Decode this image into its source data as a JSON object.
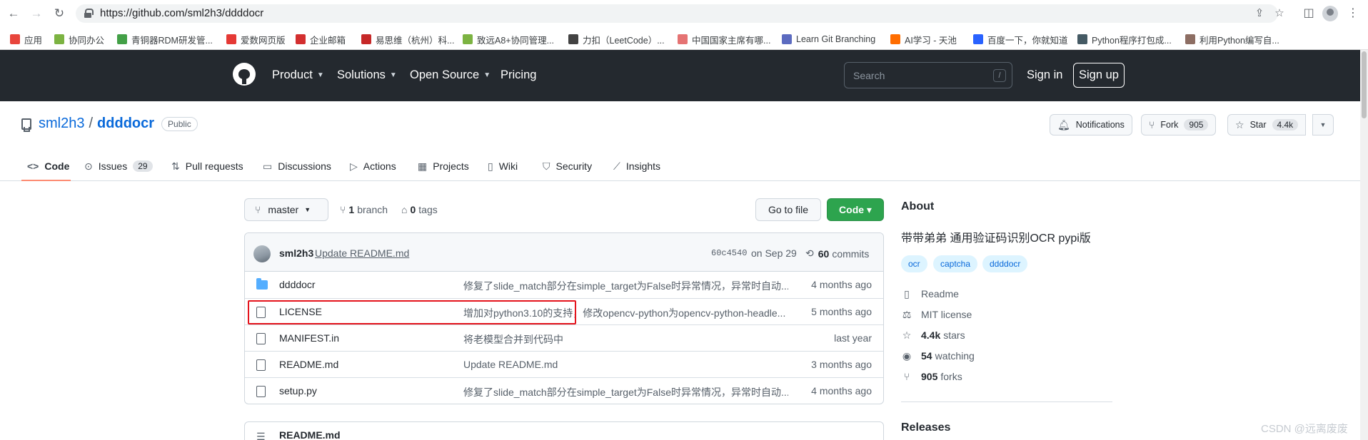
{
  "browser": {
    "url": "https://github.com/sml2h3/ddddocr",
    "back_glyph": "←",
    "forward_glyph": "→",
    "reload_glyph": "↻"
  },
  "bookmarks": [
    {
      "label": "应用",
      "color": "#e8453c"
    },
    {
      "label": "协同办公",
      "color": "#7cb342"
    },
    {
      "label": "青铜器RDM研发管...",
      "color": "#43a047"
    },
    {
      "label": "爱数网页版",
      "color": "#e53935"
    },
    {
      "label": "企业邮箱",
      "color": "#d32f2f"
    },
    {
      "label": "易思维（杭州）科...",
      "color": "#c62828"
    },
    {
      "label": "致远A8+协同管理...",
      "color": "#7cb342"
    },
    {
      "label": "力扣（LeetCode）...",
      "color": "#424242"
    },
    {
      "label": "中国国家主席有哪...",
      "color": "#e57373"
    },
    {
      "label": "Learn Git Branching",
      "color": "#5c6bc0"
    },
    {
      "label": "AI学习 - 天池",
      "color": "#ff6d00"
    },
    {
      "label": "百度一下，你就知道",
      "color": "#2962ff"
    },
    {
      "label": "Python程序打包成...",
      "color": "#455a64"
    },
    {
      "label": "利用Python编写自...",
      "color": "#8d6e63"
    }
  ],
  "gh_header": {
    "nav": [
      "Product",
      "Solutions",
      "Open Source",
      "Pricing"
    ],
    "search_placeholder": "Search",
    "search_key": "/",
    "sign_in": "Sign in",
    "sign_up": "Sign up"
  },
  "repo": {
    "owner": "sml2h3",
    "sep": "/",
    "name": "ddddocr",
    "visibility": "Public",
    "notifications": "Notifications",
    "fork_label": "Fork",
    "fork_count": "905",
    "star_label": "Star",
    "star_count": "4.4k"
  },
  "tabs": [
    {
      "label": "Code",
      "icon": "<>",
      "counter": ""
    },
    {
      "label": "Issues",
      "icon": "⊙",
      "counter": "29"
    },
    {
      "label": "Pull requests",
      "icon": "⇅",
      "counter": ""
    },
    {
      "label": "Discussions",
      "icon": "▭",
      "counter": ""
    },
    {
      "label": "Actions",
      "icon": "▷",
      "counter": ""
    },
    {
      "label": "Projects",
      "icon": "▦",
      "counter": ""
    },
    {
      "label": "Wiki",
      "icon": "▯",
      "counter": ""
    },
    {
      "label": "Security",
      "icon": "⛉",
      "counter": ""
    },
    {
      "label": "Insights",
      "icon": "⟋",
      "counter": ""
    }
  ],
  "toolbar": {
    "branch": "master",
    "branch_count": "1",
    "branch_word": "branch",
    "tag_count": "0",
    "tag_word": "tags",
    "goto_file": "Go to file",
    "code": "Code ▾"
  },
  "commit": {
    "user": "sml2h3",
    "message": "Update README.md",
    "sha": "60c4540",
    "date": "on Sep 29",
    "count": "60",
    "count_word": "commits"
  },
  "files": [
    {
      "name": "ddddocr",
      "type": "dir",
      "message": "修复了slide_match部分在simple_target为False时异常情况，异常时自动...",
      "age": "4 months ago"
    },
    {
      "name": "LICENSE",
      "type": "file",
      "message": "增加对python3.10的支持，修改opencv-python为opencv-python-headle...",
      "age": "5 months ago"
    },
    {
      "name": "MANIFEST.in",
      "type": "file",
      "message": "将老模型合并到代码中",
      "age": "last year"
    },
    {
      "name": "README.md",
      "type": "file",
      "message": "Update README.md",
      "age": "3 months ago"
    },
    {
      "name": "setup.py",
      "type": "file",
      "message": "修复了slide_match部分在simple_target为False时异常情况，异常时自动...",
      "age": "4 months ago"
    }
  ],
  "readme": {
    "title": "README.md"
  },
  "about": {
    "heading": "About",
    "description": "带带弟弟 通用验证码识别OCR pypi版",
    "topics": [
      "ocr",
      "captcha",
      "ddddocr"
    ],
    "readme": "Readme",
    "license": "MIT license",
    "stars_count": "4.4k",
    "stars_word": "stars",
    "watching_count": "54",
    "watching_word": "watching",
    "forks_count": "905",
    "forks_word": "forks"
  },
  "releases": {
    "heading": "Releases"
  },
  "watermark": "CSDN @远离废废",
  "colors": {
    "accent": "#0969da",
    "highlight": "#e4131c",
    "code_button": "#2da44e",
    "header_bg": "#24292f"
  }
}
